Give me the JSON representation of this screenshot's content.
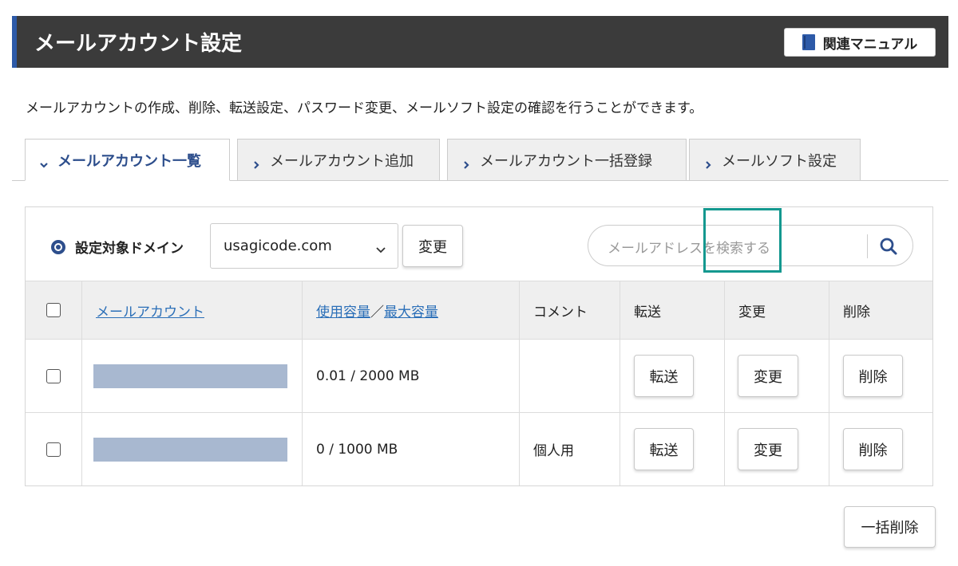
{
  "header": {
    "title": "メールアカウント設定",
    "manual_label": "関連マニュアル",
    "accent_color": "#2d5aa8"
  },
  "description": "メールアカウントの作成、削除、転送設定、パスワード変更、メールソフト設定の確認を行うことができます。",
  "tabs": [
    {
      "label": "メールアカウント一覧",
      "active": true
    },
    {
      "label": "メールアカウント追加",
      "active": false
    },
    {
      "label": "メールアカウント一括登録",
      "active": false
    },
    {
      "label": "メールソフト設定",
      "active": false
    }
  ],
  "domain": {
    "label": "設定対象ドメイン",
    "selected": "usagicode.com",
    "change_label": "変更"
  },
  "search": {
    "placeholder": "メールアドレスを検索する"
  },
  "table": {
    "headers": {
      "account": "メールアカウント",
      "usage": "使用容量",
      "separator": "／",
      "max": "最大容量",
      "comment": "コメント",
      "forward": "転送",
      "change": "変更",
      "delete": "削除"
    },
    "rows": [
      {
        "usage": "0.01 / 2000 MB",
        "comment": "",
        "forward": "転送",
        "change": "変更",
        "delete": "削除"
      },
      {
        "usage": "0 / 1000 MB",
        "comment": "個人用",
        "forward": "転送",
        "change": "変更",
        "delete": "削除"
      }
    ]
  },
  "bulk_delete_label": "一括削除",
  "highlight_color": "#14988f"
}
